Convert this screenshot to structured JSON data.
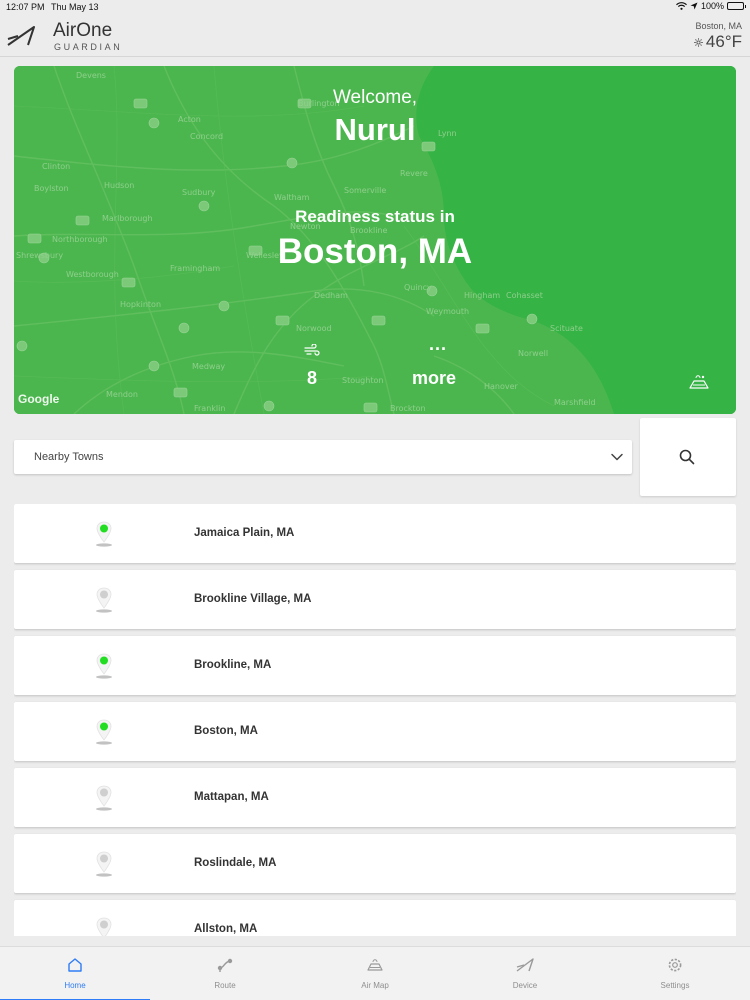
{
  "status_bar": {
    "time": "12:07 PM",
    "date": "Thu May 13",
    "battery": "100%"
  },
  "header": {
    "app_name": "AirOne",
    "app_subtitle": "GUARDIAN",
    "location": "Boston, MA",
    "temperature": "46°F"
  },
  "hero": {
    "welcome": "Welcome,",
    "username": "Nurul",
    "readiness_label": "Readiness status in",
    "city": "Boston, MA",
    "wind_value": "8",
    "more_dots": "...",
    "more_label": "more",
    "map_attribution": "Google",
    "status_color": "#3bb54a",
    "map_places": [
      "Devens",
      "Acton",
      "Concord",
      "Burlington",
      "Lynn",
      "Clinton",
      "Boylston",
      "Hudson",
      "Sudbury",
      "Waltham",
      "Somerville",
      "Revere",
      "Marlborough",
      "Northborough",
      "Shrewsbury",
      "Newton",
      "Brookline",
      "Wellesley",
      "Westborough",
      "Framingham",
      "Quincy",
      "Hingham",
      "Cohasset",
      "Dedham",
      "Weymouth",
      "Hopkinton",
      "Norwood",
      "Scituate",
      "Norwell",
      "Medway",
      "Hanover",
      "Stoughton",
      "Mendon",
      "Franklin",
      "Brockton",
      "Marshfield"
    ]
  },
  "search": {
    "dropdown_label": "Nearby Towns"
  },
  "towns": [
    {
      "name": "Jamaica Plain, MA",
      "status": "green"
    },
    {
      "name": "Brookline Village, MA",
      "status": "grey"
    },
    {
      "name": "Brookline, MA",
      "status": "green"
    },
    {
      "name": "Boston, MA",
      "status": "green"
    },
    {
      "name": "Mattapan, MA",
      "status": "grey"
    },
    {
      "name": "Roslindale, MA",
      "status": "grey"
    },
    {
      "name": "Allston, MA",
      "status": "grey"
    }
  ],
  "status_colors": {
    "green": "#22dd22",
    "grey": "#cfcfcf"
  },
  "tabs": [
    {
      "label": "Home",
      "icon": "home-icon",
      "active": true
    },
    {
      "label": "Route",
      "icon": "route-icon",
      "active": false
    },
    {
      "label": "Air Map",
      "icon": "air-map-icon",
      "active": false
    },
    {
      "label": "Device",
      "icon": "device-icon",
      "active": false
    },
    {
      "label": "Settings",
      "icon": "settings-icon",
      "active": false
    }
  ],
  "accent_color": "#2e7cf6"
}
